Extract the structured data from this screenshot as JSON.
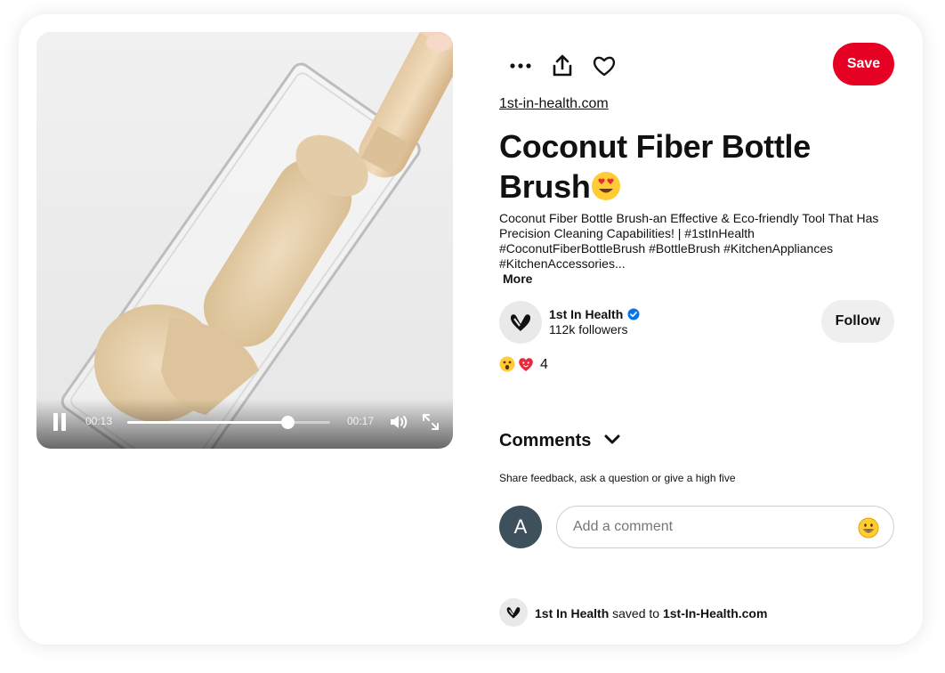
{
  "video": {
    "current_time": "00:13",
    "duration": "00:17",
    "progress": 0.79
  },
  "toolbar": {
    "more_icon": "ellipsis-icon",
    "share_icon": "share-upload-icon",
    "react_icon": "heart-outline-icon",
    "save_label": "Save"
  },
  "pin": {
    "source": "1st-in-health.com",
    "title": "Coconut Fiber Bottle Brush",
    "title_emoji": "😍",
    "description": "Coconut Fiber Bottle Brush-an Effective & Eco-friendly Tool That Has Precision Cleaning Capabilities! | #1stInHealth #CoconutFiberBottleBrush #BottleBrush #KitchenAppliances #KitchenAccessories...",
    "more_label": "More"
  },
  "author": {
    "name": "1st In Health",
    "followers": "112k followers",
    "verified": true,
    "follow_label": "Follow"
  },
  "reactions": {
    "icons": [
      "wow-face-icon",
      "heart-face-icon"
    ],
    "count": "4"
  },
  "comments": {
    "heading": "Comments",
    "hint": "Share feedback, ask a question or give a high five",
    "user_initial": "A",
    "placeholder": "Add a comment"
  },
  "saved_by": {
    "user": "1st In Health",
    "verb": " saved to ",
    "board": "1st-In-Health.com"
  },
  "colors": {
    "save": "#e60023",
    "follow_bg": "#efefef",
    "verified": "#0074e8",
    "user_avatar": "#3e505c"
  }
}
